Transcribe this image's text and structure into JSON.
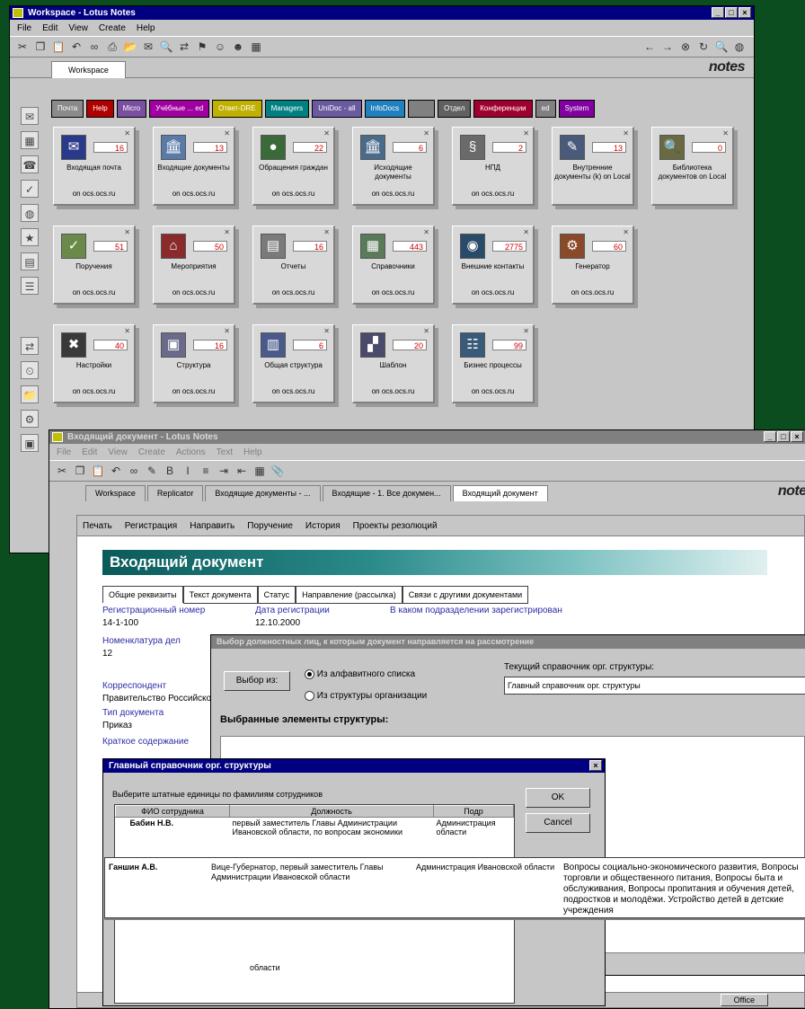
{
  "workspace_window": {
    "title": "Workspace - Lotus Notes",
    "menu": [
      "File",
      "Edit",
      "View",
      "Create",
      "Help"
    ],
    "tab": "Workspace",
    "brand": "notes",
    "page_tabs": [
      {
        "label": "Почта",
        "color": "#8a8a8a"
      },
      {
        "label": "Help",
        "color": "#b00000"
      },
      {
        "label": "Micro",
        "color": "#7a4fa0"
      },
      {
        "label": "Учёбные ... ed",
        "color": "#a000a0"
      },
      {
        "label": "Ответ-DRE",
        "color": "#c0b000"
      },
      {
        "label": "Managers",
        "color": "#008080"
      },
      {
        "label": "UniDoc - all",
        "color": "#6a5aa0"
      },
      {
        "label": "InfoDocs",
        "color": "#2080c0"
      },
      {
        "label": "",
        "color": "#808080"
      },
      {
        "label": "Отдел",
        "color": "#606060"
      },
      {
        "label": "Конференции",
        "color": "#a00030"
      },
      {
        "label": "ed",
        "color": "#808080"
      },
      {
        "label": "System",
        "color": "#8000a0"
      }
    ],
    "tiles": [
      {
        "name": "Входящая почта",
        "db": "on ocs.ocs.ru",
        "count": "16",
        "icon": "✉",
        "color": "#2a3a8a"
      },
      {
        "name": "Входящие документы",
        "db": "on ocs.ocs.ru",
        "count": "13",
        "icon": "🏛",
        "color": "#5a7aa8"
      },
      {
        "name": "Обращения граждан",
        "db": "on ocs.ocs.ru",
        "count": "22",
        "icon": "●",
        "color": "#3a6a3a"
      },
      {
        "name": "Исходящие документы",
        "db": "on ocs.ocs.ru",
        "count": "6",
        "icon": "🏛",
        "color": "#4a6a8a"
      },
      {
        "name": "НПД",
        "db": "on ocs.ocs.ru",
        "count": "2",
        "icon": "§",
        "color": "#6a6a6a"
      },
      {
        "name": "Внутренние документы (k) on Local",
        "db": "",
        "count": "13",
        "icon": "✎",
        "color": "#4a5a7a"
      },
      {
        "name": "Библиотека документов on Local",
        "db": "",
        "count": "0",
        "icon": "🔍",
        "color": "#6a6a40"
      },
      {
        "name": "Поручения",
        "db": "on ocs.ocs.ru",
        "count": "51",
        "icon": "✓",
        "color": "#6a8a4a"
      },
      {
        "name": "Мероприятия",
        "db": "on ocs.ocs.ru",
        "count": "50",
        "icon": "⌂",
        "color": "#8a2a2a"
      },
      {
        "name": "Отчеты",
        "db": "on ocs.ocs.ru",
        "count": "16",
        "icon": "▤",
        "color": "#7a7a7a"
      },
      {
        "name": "Справочники",
        "db": "on ocs.ocs.ru",
        "count": "443",
        "icon": "▦",
        "color": "#5a7a5a"
      },
      {
        "name": "Внешние контакты",
        "db": "on ocs.ocs.ru",
        "count": "2775",
        "icon": "◉",
        "color": "#2a4a6a"
      },
      {
        "name": "Генератор",
        "db": "on ocs.ocs.ru",
        "count": "60",
        "icon": "⚙",
        "color": "#8a4a2a"
      },
      {
        "name": "Настройки",
        "db": "on ocs.ocs.ru",
        "count": "40",
        "icon": "✖",
        "color": "#3a3a3a"
      },
      {
        "name": "Структура",
        "db": "on ocs.ocs.ru",
        "count": "16",
        "icon": "▣",
        "color": "#6a6a8a"
      },
      {
        "name": "Общая структура",
        "db": "on ocs.ocs.ru",
        "count": "6",
        "icon": "▥",
        "color": "#4a5a8a"
      },
      {
        "name": "Шаблон",
        "db": "on ocs.ocs.ru",
        "count": "20",
        "icon": "▞",
        "color": "#4a4a6a"
      },
      {
        "name": "Бизнес процессы",
        "db": "on ocs.ocs.ru",
        "count": "99",
        "icon": "☷",
        "color": "#3a5a7a"
      }
    ]
  },
  "doc_window": {
    "title": "Входящий документ - Lotus Notes",
    "menu": [
      "File",
      "Edit",
      "View",
      "Create",
      "Actions",
      "Text",
      "Help"
    ],
    "tabs": [
      "Workspace",
      "Replicator",
      "Входящие документы - ...",
      "Входящие - 1. Все докумен...",
      "Входящий документ"
    ],
    "brand": "notes",
    "actions": [
      "Печать",
      "Регистрация",
      "Направить",
      "Поручение",
      "История",
      "Проекты резолюций"
    ],
    "doc_title": "Входящий документ",
    "section_tabs": [
      "Общие реквизиты",
      "Текст документа",
      "Статус",
      "Направление (рассылка)",
      "Связи с другими документами"
    ],
    "fields": {
      "reg_label": "Регистрационный номер",
      "reg_value": "14-1-100",
      "date_label": "Дата регистрации",
      "date_value": "12.10.2000",
      "unit_label": "В каком подразделении зарегистрирован",
      "nomen_label": "Номенклатура дел",
      "nomen_value": "12",
      "corr_label": "Корреспондент",
      "corr_value": "Правительство Российской",
      "type_label": "Тип документа",
      "type_value": "Приказ",
      "summary_label": "Краткое содержание"
    },
    "status_bar": "Office"
  },
  "select_dialog": {
    "title": "Выбор должностных лиц, к которым документ направляется на рассмотрение",
    "select_button": "Выбор из:",
    "option1": "Из алфавитного списка",
    "option2": "Из структуры организации",
    "current_label": "Текущий справочник орг. структуры:",
    "current_value": "Главный справочник орг. структуры",
    "selected_label": "Выбранные элементы структуры:"
  },
  "struct_dialog": {
    "title": "Главный справочник орг. структуры",
    "instruction": "Выберите штатные единицы по фамилиям сотрудников",
    "ok": "OK",
    "cancel": "Cancel",
    "columns": [
      "ФИО сотрудника",
      "Должность",
      "Подр"
    ],
    "rows": [
      {
        "name": "Бабин Н.В.",
        "position": "первый заместитель Главы Администрации Ивановской области, по вопросам экономики",
        "dept": "Администрация области"
      },
      {
        "name": "Ганшин А.В.",
        "position": "Вице-Губернатор, первый заместитель Главы Администрации Ивановской области",
        "dept": "Администрация Ивановской области",
        "extra": "Вопросы социально-экономического развития, Вопросы торговли и общественного питания, Вопросы быта и обслуживания, Вопросы пропитания и обучения детей, подростков и молодёжи. Устройство детей в детские учреждения"
      },
      {
        "name": "",
        "position": "области",
        "dept": ""
      }
    ]
  }
}
